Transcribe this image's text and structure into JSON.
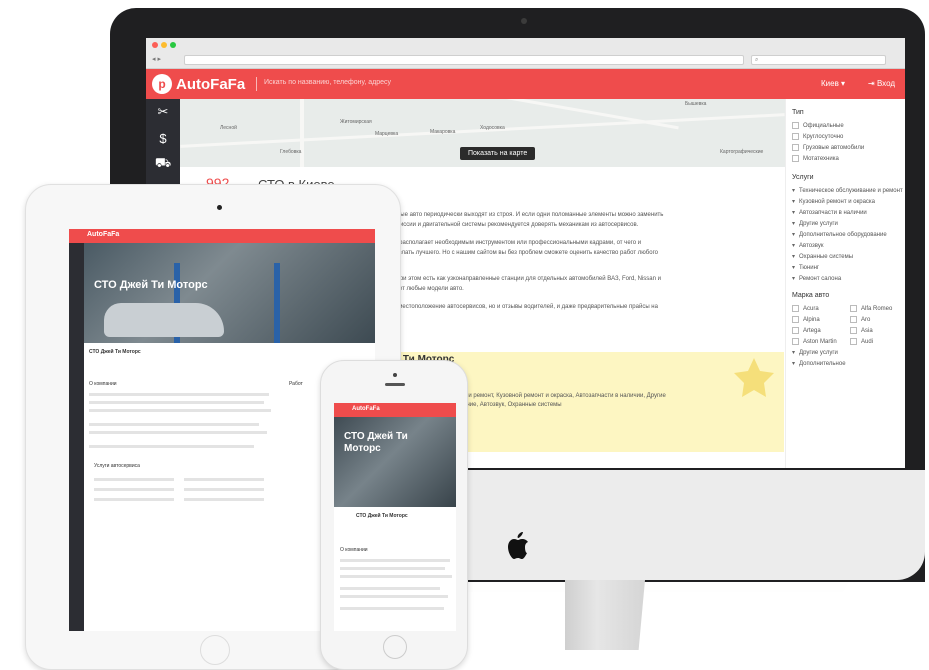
{
  "brand": {
    "logo_text": "AutoFaFa",
    "logo_glyph": "p",
    "accent": "#ef4c4c",
    "nav_dark": "#2c2d33"
  },
  "header": {
    "search_placeholder": "Искать по названию, телефону, адресу",
    "city": "Киев ▾",
    "login": "Вход"
  },
  "map": {
    "show_button": "Показать на карте",
    "labels": [
      "Бышевка",
      "Лесной",
      "Житомирская",
      "Макаровка",
      "Марцевка",
      "Ходосовка",
      "Глебовка",
      "Картографические"
    ]
  },
  "main": {
    "count": "992",
    "title": "СТО в Киеве",
    "paragraphs": [
      "даленные авто периодически выходят из строя. И если одни поломанные элементы можно заменить",
      "трансмиссии и двигательной системы рекомендуется доверять механикам из автосервисов.",
      "ми, не располагает необходимым инструментом или профессиональными кадрами, от чего и",
      "лает желать лучшего. Но с нашим сайтом вы без проблем сможете оценить качество работ любого",
      "СТО. При этом есть как узконаправленные станции для отдельных автомобилей ВАЗ, Ford, Nissan и",
      "онтирует любые модели авто.",
      "ально местоположение автосервисов, но и отзывы водителей, и даже предварительные прайсы на"
    ],
    "card_title": "й Ти Моторс",
    "card_services": "ие и ремонт, Кузовной ремонт и окраска, Автозапчасти в наличии, Другие",
    "card_services2": "вание, Автозвук, Охранные системы"
  },
  "filters": {
    "type_head": "Тип",
    "types": [
      "Официальные",
      "Круглосуточно",
      "Грузовые автомобили",
      "Мотатехника"
    ],
    "services_head": "Услуги",
    "services": [
      "Техническое обслуживание и ремонт",
      "Кузовной ремонт и окраска",
      "Автозапчасти в наличии",
      "Другие услуги",
      "Дополнительное оборудование",
      "Автозвук",
      "Охранные системы",
      "Тюнинг",
      "Ремонт салона"
    ],
    "brand_head": "Марка авто",
    "brands": [
      "Acura",
      "Alfa Romeo",
      "Alpina",
      "Aro",
      "Artega",
      "Asia",
      "Aston Martin",
      "Audi"
    ],
    "services_repeat": [
      "Другие услуги",
      "Дополнительное"
    ]
  },
  "ipad": {
    "hero_title": "СТО Джей Ти Моторс",
    "company_name": "СТО Джей Ти Моторс",
    "about": "О компании",
    "services": "Услуги автосервиса",
    "works": "Работ"
  },
  "iphone": {
    "hero_title": "СТО Джей Ти Моторс",
    "company_name": "СТО Джей Ти Моторс",
    "about": "О компании"
  }
}
